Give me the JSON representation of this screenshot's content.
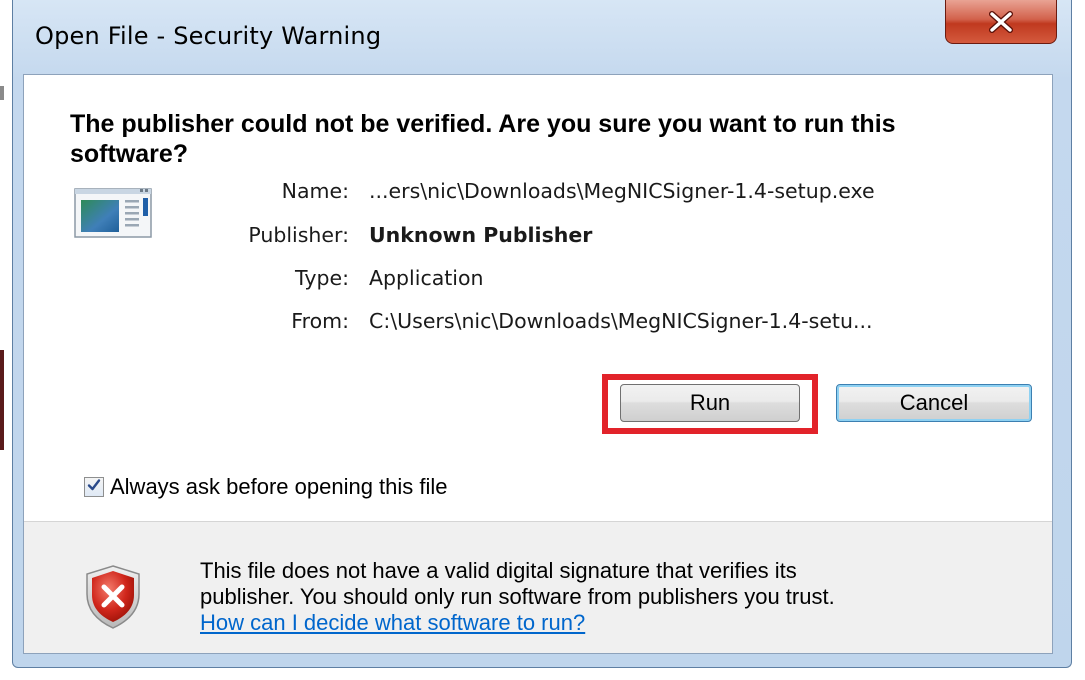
{
  "window": {
    "title": "Open File - Security Warning"
  },
  "heading": "The publisher could not be verified.  Are you sure you want to run this software?",
  "file_info": {
    "name_label": "Name:",
    "name_value": "...ers\\nic\\Downloads\\MegNICSigner-1.4-setup.exe",
    "publisher_label": "Publisher:",
    "publisher_value": "Unknown Publisher",
    "type_label": "Type:",
    "type_value": "Application",
    "from_label": "From:",
    "from_value": "C:\\Users\\nic\\Downloads\\MegNICSigner-1.4-setu..."
  },
  "buttons": {
    "run_label": "Run",
    "cancel_label": "Cancel"
  },
  "checkbox": {
    "label": "Always ask before opening this file",
    "checked": true
  },
  "warning": {
    "line1": "This file does not have a valid digital signature that verifies its",
    "line2": "publisher.  You should only run software from publishers you trust.",
    "link_text": "How can I decide what software to run?"
  },
  "colors": {
    "highlight": "#e2232a",
    "link": "#0066cc",
    "close_button": "#c0391f"
  },
  "icons": {
    "title_close": "close-icon",
    "application": "application-icon",
    "checkbox_check": "checkmark-icon",
    "warning": "shield-error-icon"
  }
}
